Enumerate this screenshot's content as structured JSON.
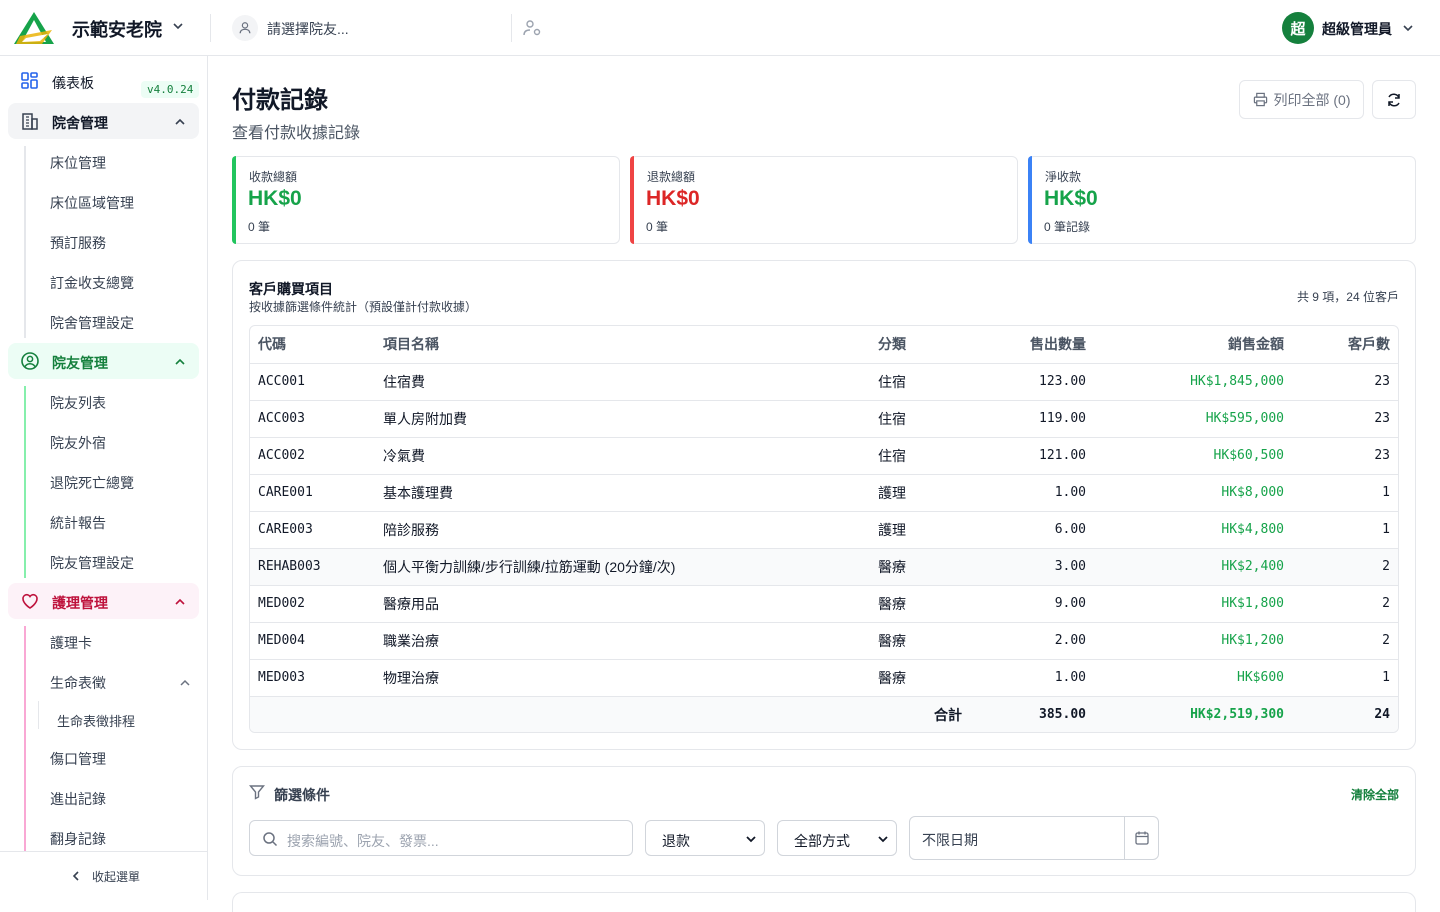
{
  "header": {
    "org_name": "示範安老院",
    "resident_placeholder": "請選擇院友...",
    "user_avatar": "超",
    "user_name": "超級管理員"
  },
  "sidebar": {
    "dashboard": "儀表板",
    "version": "v4.0.24",
    "groups": [
      {
        "label": "院舍管理",
        "items": [
          "床位管理",
          "床位區域管理",
          "預訂服務",
          "訂金收支總覽",
          "院舍管理設定"
        ]
      },
      {
        "label": "院友管理",
        "items": [
          "院友列表",
          "院友外宿",
          "退院死亡總覽",
          "統計報告",
          "院友管理設定"
        ]
      },
      {
        "label": "護理管理",
        "items": [
          "護理卡",
          "生命表徵",
          "生命表徵排程",
          "傷口管理",
          "進出記錄",
          "翻身記錄"
        ]
      }
    ],
    "collapse": "收起選單"
  },
  "page": {
    "title": "付款記錄",
    "subtitle": "查看付款收據記錄",
    "print_all": "列印全部 (0)"
  },
  "stats": [
    {
      "label": "收款總額",
      "value": "HK$0",
      "count": "0 筆",
      "color": "#16a34a"
    },
    {
      "label": "退款總額",
      "value": "HK$0",
      "count": "0 筆",
      "color": "#dc2626"
    },
    {
      "label": "淨收款",
      "value": "HK$0",
      "count": "0 筆記錄",
      "color": "#16a34a"
    }
  ],
  "purchases": {
    "title": "客戶購買項目",
    "subtitle": "按收據篩選條件統計（預設僅計付款收據）",
    "summary": "共 9 項，24 位客戶",
    "columns": [
      "代碼",
      "項目名稱",
      "分類",
      "售出數量",
      "銷售金額",
      "客戶數"
    ],
    "rows": [
      {
        "code": "ACC001",
        "name": "住宿費",
        "category": "住宿",
        "qty": "123.00",
        "amount": "HK$1,845,000",
        "customers": "23"
      },
      {
        "code": "ACC003",
        "name": "單人房附加費",
        "category": "住宿",
        "qty": "119.00",
        "amount": "HK$595,000",
        "customers": "23"
      },
      {
        "code": "ACC002",
        "name": "冷氣費",
        "category": "住宿",
        "qty": "121.00",
        "amount": "HK$60,500",
        "customers": "23"
      },
      {
        "code": "CARE001",
        "name": "基本護理費",
        "category": "護理",
        "qty": "1.00",
        "amount": "HK$8,000",
        "customers": "1"
      },
      {
        "code": "CARE003",
        "name": "陪診服務",
        "category": "護理",
        "qty": "6.00",
        "amount": "HK$4,800",
        "customers": "1"
      },
      {
        "code": "REHAB003",
        "name": "個人平衡力訓練/步行訓練/拉筋運動 (20分鐘/次)",
        "category": "醫療",
        "qty": "3.00",
        "amount": "HK$2,400",
        "customers": "2"
      },
      {
        "code": "MED002",
        "name": "醫療用品",
        "category": "醫療",
        "qty": "9.00",
        "amount": "HK$1,800",
        "customers": "2"
      },
      {
        "code": "MED004",
        "name": "職業治療",
        "category": "醫療",
        "qty": "2.00",
        "amount": "HK$1,200",
        "customers": "2"
      },
      {
        "code": "MED003",
        "name": "物理治療",
        "category": "醫療",
        "qty": "1.00",
        "amount": "HK$600",
        "customers": "1"
      }
    ],
    "total": {
      "label": "合計",
      "qty": "385.00",
      "amount": "HK$2,519,300",
      "customers": "24"
    }
  },
  "filters": {
    "title": "篩選條件",
    "clear_all": "清除全部",
    "search_placeholder": "搜索編號、院友、發票...",
    "type_value": "退款",
    "method_value": "全部方式",
    "date_value": "不限日期"
  }
}
